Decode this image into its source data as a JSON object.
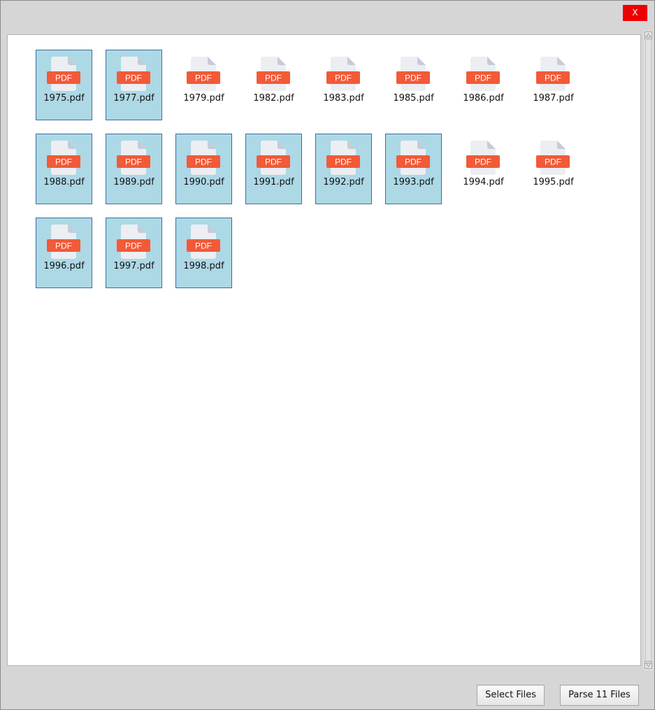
{
  "window": {
    "close_label": "X"
  },
  "files": [
    {
      "name": "1975.pdf",
      "selected": true
    },
    {
      "name": "1977.pdf",
      "selected": true
    },
    {
      "name": "1979.pdf",
      "selected": false
    },
    {
      "name": "1982.pdf",
      "selected": false
    },
    {
      "name": "1983.pdf",
      "selected": false
    },
    {
      "name": "1985.pdf",
      "selected": false
    },
    {
      "name": "1986.pdf",
      "selected": false
    },
    {
      "name": "1987.pdf",
      "selected": false
    },
    {
      "name": "1988.pdf",
      "selected": true
    },
    {
      "name": "1989.pdf",
      "selected": true
    },
    {
      "name": "1990.pdf",
      "selected": true
    },
    {
      "name": "1991.pdf",
      "selected": true
    },
    {
      "name": "1992.pdf",
      "selected": true
    },
    {
      "name": "1993.pdf",
      "selected": true
    },
    {
      "name": "1994.pdf",
      "selected": false
    },
    {
      "name": "1995.pdf",
      "selected": false
    },
    {
      "name": "1996.pdf",
      "selected": true
    },
    {
      "name": "1997.pdf",
      "selected": true
    },
    {
      "name": "1998.pdf",
      "selected": true
    }
  ],
  "file_icon": {
    "name": "pdf-file-icon",
    "badge_text": "PDF",
    "badge_color": "#f25a38",
    "page_color": "#eceef2",
    "fold_color": "#c5ccd8"
  },
  "selection_color": "#add8e6",
  "buttons": {
    "select_files": "Select Files",
    "parse_files": "Parse 11 Files"
  }
}
